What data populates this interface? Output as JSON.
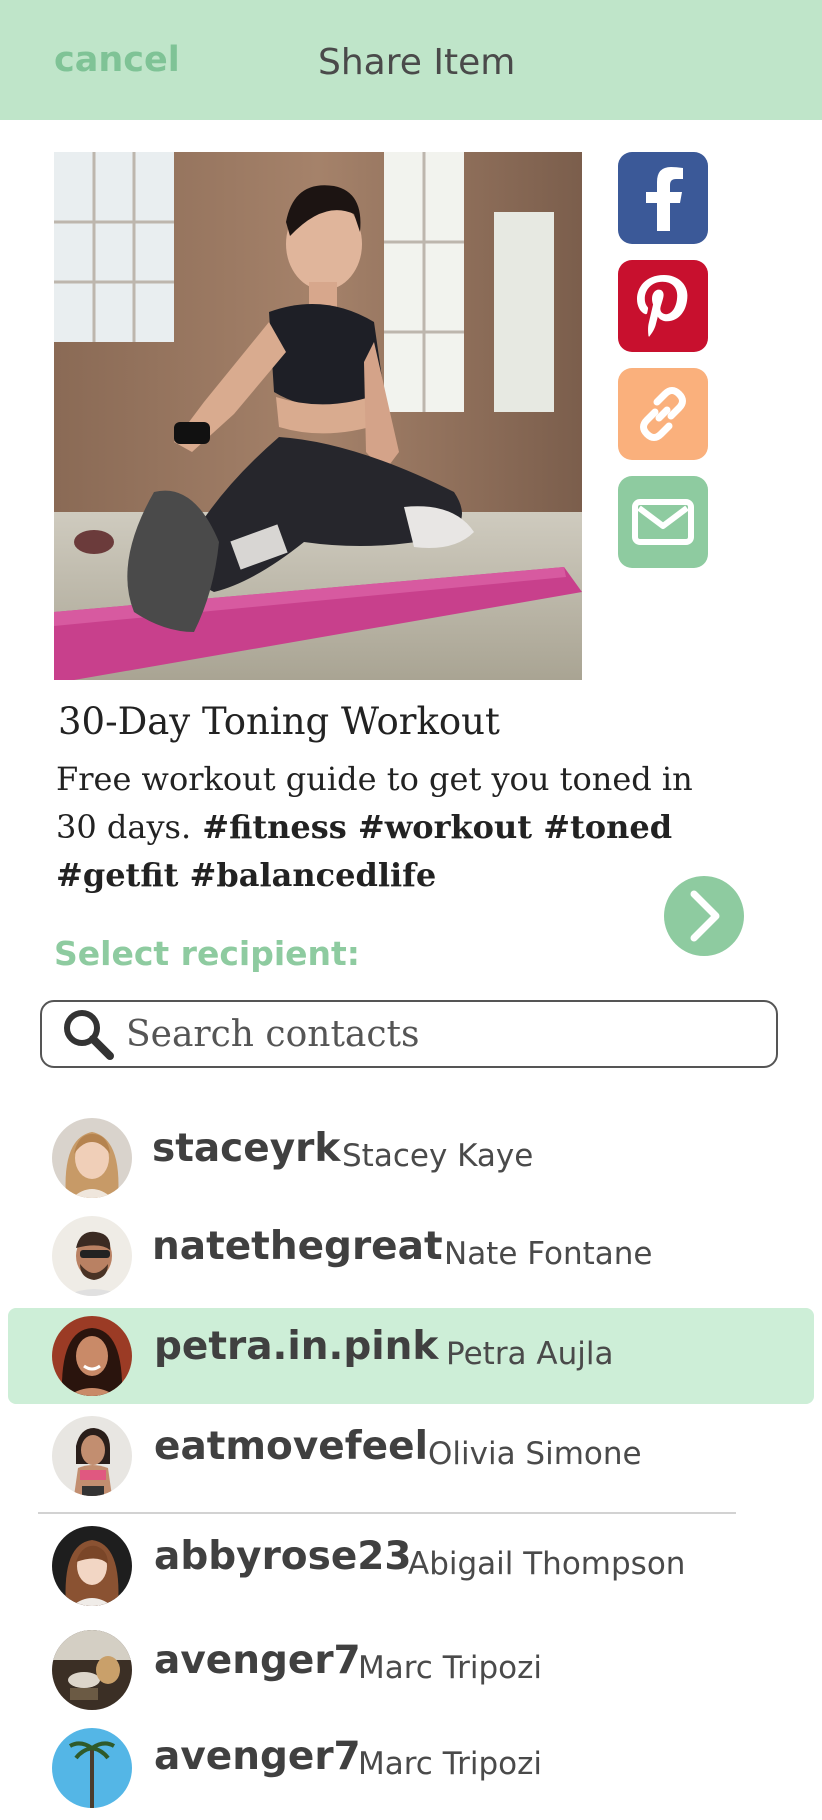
{
  "header": {
    "cancel_label": "cancel",
    "title": "Share Item"
  },
  "share": {
    "facebook": {
      "icon": "facebook-icon",
      "color": "#3b5998"
    },
    "pinterest": {
      "icon": "pinterest-icon",
      "color": "#c8102e"
    },
    "link": {
      "icon": "link-icon",
      "color": "#fab07c"
    },
    "email": {
      "icon": "envelope-icon",
      "color": "#8ecba0"
    }
  },
  "item": {
    "title": "30-Day Toning Workout",
    "description": "Free workout guide to get you toned in 30 days.",
    "tags": " #fitness #workout #toned #getfit #balancedlife"
  },
  "recipients": {
    "label": "Select recipient:",
    "search_placeholder": "Search contacts",
    "contacts": [
      {
        "handle": "staceyrk",
        "name": "Stacey Kaye"
      },
      {
        "handle": "natethegreat",
        "name": "Nate Fontane"
      },
      {
        "handle": "petra.in.pink",
        "name": "Petra Aujla",
        "selected": true
      },
      {
        "handle": "eatmovefeel",
        "name": "Olivia Simone"
      },
      {
        "handle": "abbyrose23",
        "name": "Abigail Thompson"
      },
      {
        "handle": "avenger7",
        "name": "Marc Tripozi"
      },
      {
        "handle": "avenger7",
        "name": "Marc Tripozi"
      }
    ]
  },
  "colors": {
    "accent": "#8ecba0",
    "header_bg": "#bfe5c9",
    "selected_row": "#cdeed7"
  }
}
